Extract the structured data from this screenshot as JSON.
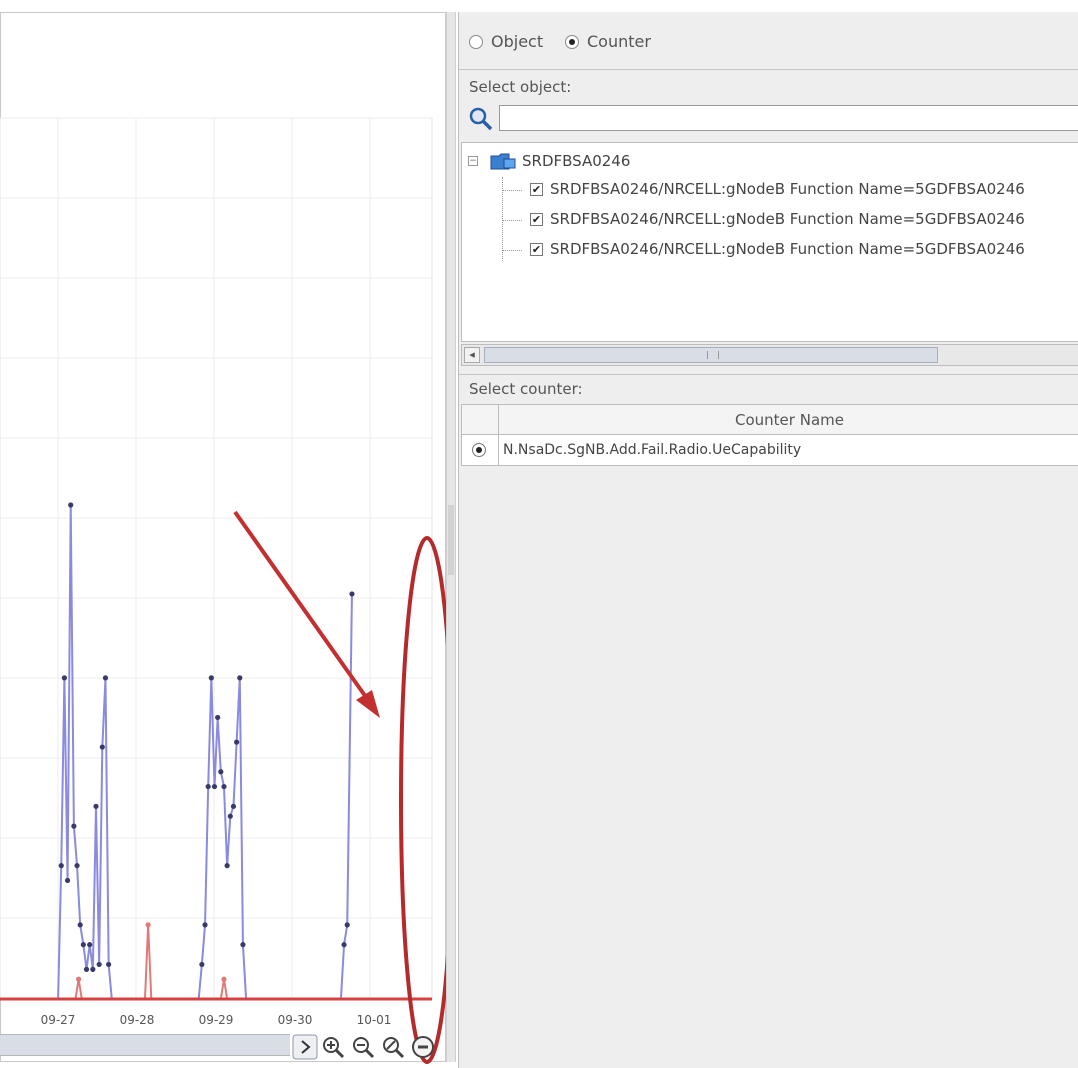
{
  "mode": {
    "options": [
      {
        "label": "Object",
        "selected": false
      },
      {
        "label": "Counter",
        "selected": true
      }
    ]
  },
  "object_panel": {
    "label": "Select object:",
    "search_value": "",
    "root": "SRDFBSA0246",
    "items": [
      {
        "label": "SRDFBSA0246/NRCELL:gNodeB Function Name=5GDFBSA0246",
        "checked": true
      },
      {
        "label": "SRDFBSA0246/NRCELL:gNodeB Function Name=5GDFBSA0246",
        "checked": true
      },
      {
        "label": "SRDFBSA0246/NRCELL:gNodeB Function Name=5GDFBSA0246",
        "checked": true
      }
    ]
  },
  "counter_panel": {
    "label": "Select counter:",
    "column_header": "Counter Name",
    "rows": [
      {
        "name": "N.NsaDc.SgNB.Add.Fail.Radio.UeCapability",
        "selected": true
      }
    ]
  },
  "chart_data": {
    "type": "line",
    "x_tick_labels": [
      "09-27",
      "09-28",
      "09-29",
      "09-30",
      "10-01"
    ],
    "ylim": [
      0,
      1
    ],
    "grid": true,
    "series": [
      {
        "color": "#8a8ae0",
        "points": [
          [
            0.0,
            0.0
          ],
          [
            0.52,
            0.0
          ],
          [
            0.56,
            0.27
          ],
          [
            0.6,
            0.65
          ],
          [
            0.64,
            0.24
          ],
          [
            0.68,
            1.0
          ],
          [
            0.72,
            0.35
          ],
          [
            0.76,
            0.27
          ],
          [
            0.8,
            0.15
          ],
          [
            0.84,
            0.11
          ],
          [
            0.88,
            0.06
          ],
          [
            0.92,
            0.11
          ],
          [
            0.96,
            0.06
          ],
          [
            1.0,
            0.39
          ],
          [
            1.04,
            0.07
          ],
          [
            1.08,
            0.51
          ],
          [
            1.12,
            0.65
          ],
          [
            1.16,
            0.07
          ],
          [
            1.2,
            0.0
          ],
          [
            2.3,
            0.0
          ],
          [
            2.34,
            0.07
          ],
          [
            2.38,
            0.15
          ],
          [
            2.42,
            0.43
          ],
          [
            2.46,
            0.65
          ],
          [
            2.5,
            0.43
          ],
          [
            2.54,
            0.57
          ],
          [
            2.58,
            0.46
          ],
          [
            2.62,
            0.43
          ],
          [
            2.66,
            0.27
          ],
          [
            2.7,
            0.37
          ],
          [
            2.74,
            0.39
          ],
          [
            2.78,
            0.52
          ],
          [
            2.82,
            0.65
          ],
          [
            2.86,
            0.11
          ],
          [
            2.9,
            0.0
          ],
          [
            4.1,
            0.0
          ],
          [
            4.14,
            0.11
          ],
          [
            4.18,
            0.15
          ],
          [
            4.24,
            0.82
          ]
        ]
      },
      {
        "color": "#e07a7a",
        "points": [
          [
            0.0,
            0.0
          ],
          [
            0.74,
            0.0
          ],
          [
            0.78,
            0.04
          ],
          [
            0.82,
            0.0
          ],
          [
            1.62,
            0.0
          ],
          [
            1.66,
            0.15
          ],
          [
            1.7,
            0.0
          ],
          [
            2.58,
            0.0
          ],
          [
            2.62,
            0.04
          ],
          [
            2.66,
            0.0
          ],
          [
            4.3,
            0.0
          ]
        ]
      }
    ]
  }
}
